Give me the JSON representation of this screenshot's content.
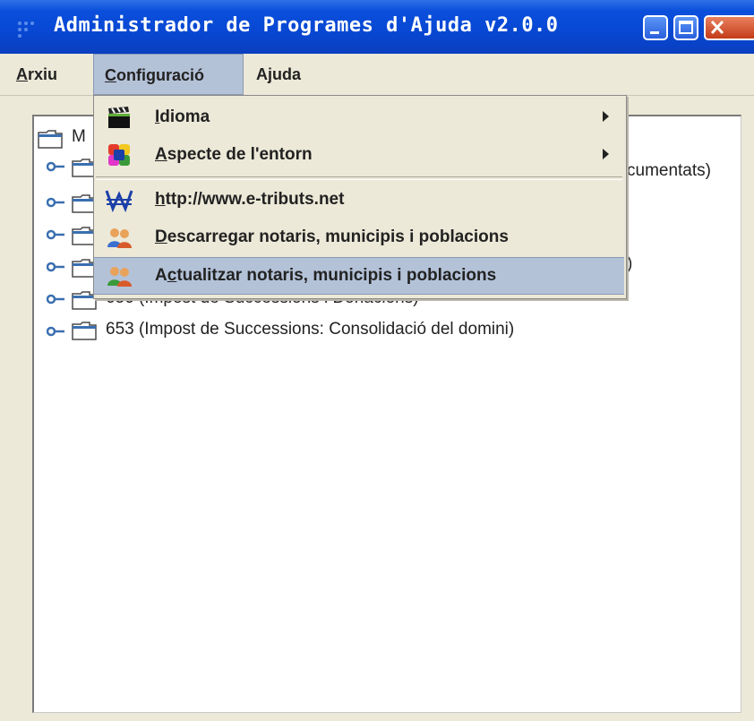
{
  "window": {
    "title": "Administrador de Programes d'Ajuda v2.0.0"
  },
  "menubar": {
    "items": [
      {
        "pre": "",
        "ul": "A",
        "post": "rxiu"
      },
      {
        "pre": "",
        "ul": "C",
        "post": "onfiguració"
      },
      {
        "pre": "A",
        "ul": "j",
        "post": "uda"
      }
    ]
  },
  "dropdown": {
    "items": [
      {
        "pre": "",
        "ul": "I",
        "post": "dioma",
        "icon": "clapperboard-icon",
        "submenu": true
      },
      {
        "pre": "",
        "ul": "A",
        "post": "specte de l'entorn",
        "icon": "color-palette-icon",
        "submenu": true
      },
      {
        "pre": "",
        "ul": "h",
        "post": "ttp://www.e-tributs.net",
        "icon": "w-logo-icon",
        "submenu": false
      },
      {
        "pre": "",
        "ul": "D",
        "post": "escarregar notaris, municipis i poblacions",
        "icon": "users-icon",
        "submenu": false
      },
      {
        "pre": "A",
        "ul": "c",
        "post": "tualitzar notaris, municipis i poblacions",
        "icon": "users-update-icon",
        "submenu": false,
        "highlighted": true
      }
    ]
  },
  "tree": {
    "root_visible": "M",
    "rows": [
      {
        "visible_text": "cumentats)"
      },
      {
        "visible_text": ""
      },
      {
        "visible_text": ""
      },
      {
        "visible_text": ")"
      },
      {
        "visible_text": "656 (Impost de Successions i Donacions)"
      },
      {
        "visible_text": "653 (Impost de Successions: Consolidació del domini)"
      }
    ]
  },
  "colors": {
    "titlebar": "#0a4fdc",
    "menu_highlight": "#b4c2d8",
    "window_bg": "#ece9d8"
  }
}
